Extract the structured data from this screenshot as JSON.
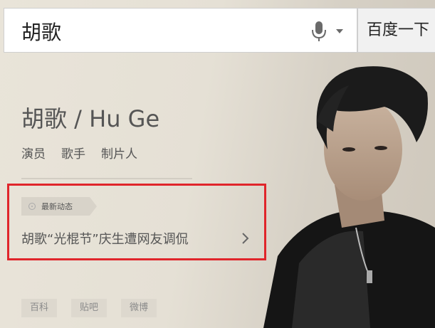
{
  "search": {
    "query": "胡歌",
    "button_label": "百度一下"
  },
  "profile": {
    "title": "胡歌 / Hu Ge",
    "roles": [
      "演员",
      "歌手",
      "制片人"
    ]
  },
  "news": {
    "tag": "最新动态",
    "headline": "胡歌“光棍节”庆生遭网友调侃"
  },
  "links": [
    "百科",
    "贴吧",
    "微博"
  ],
  "colors": {
    "highlight_border": "#e0252b",
    "background": "#e7e2d8"
  }
}
